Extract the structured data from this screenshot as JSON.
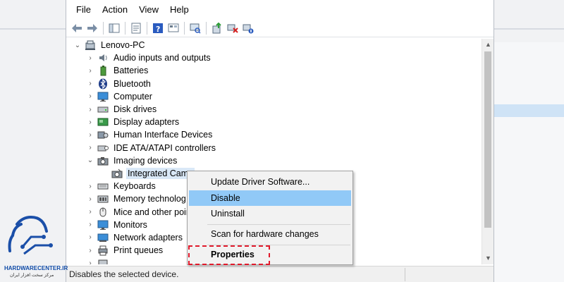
{
  "menu": [
    "File",
    "Action",
    "View",
    "Help"
  ],
  "tree": {
    "root": "Lenovo-PC",
    "items": [
      {
        "label": "Audio inputs and outputs",
        "icon": "speaker-icon",
        "expanded": false
      },
      {
        "label": "Batteries",
        "icon": "battery-icon",
        "expanded": false
      },
      {
        "label": "Bluetooth",
        "icon": "bluetooth-icon",
        "expanded": false
      },
      {
        "label": "Computer",
        "icon": "monitor-icon",
        "expanded": false
      },
      {
        "label": "Disk drives",
        "icon": "disk-drive-icon",
        "expanded": false
      },
      {
        "label": "Display adapters",
        "icon": "display-adapter-icon",
        "expanded": false
      },
      {
        "label": "Human Interface Devices",
        "icon": "hid-icon",
        "expanded": false
      },
      {
        "label": "IDE ATA/ATAPI controllers",
        "icon": "ide-controller-icon",
        "expanded": false
      },
      {
        "label": "Imaging devices",
        "icon": "camera-icon",
        "expanded": true
      },
      {
        "label": "Integrated Came",
        "icon": "webcam-icon",
        "child": true
      },
      {
        "label": "Keyboards",
        "icon": "keyboard-icon",
        "expanded": false
      },
      {
        "label": "Memory technolog",
        "icon": "memory-icon",
        "expanded": false
      },
      {
        "label": "Mice and other poir",
        "icon": "mouse-icon",
        "expanded": false
      },
      {
        "label": "Monitors",
        "icon": "monitor-icon",
        "expanded": false
      },
      {
        "label": "Network adapters",
        "icon": "network-icon",
        "expanded": false
      },
      {
        "label": "Print queues",
        "icon": "printer-icon",
        "expanded": false
      }
    ]
  },
  "context_menu": {
    "update": "Update Driver Software...",
    "disable": "Disable",
    "uninstall": "Uninstall",
    "scan": "Scan for hardware changes",
    "properties": "Properties"
  },
  "status": "Disables the selected device.",
  "logo": {
    "site": "HARDWARECENTER.IR",
    "tagline": "مرکز سخت افزار ایران"
  },
  "colors": {
    "highlight": "#91c9f7",
    "dash": "#e0192b",
    "brand": "#0f4aa6"
  }
}
